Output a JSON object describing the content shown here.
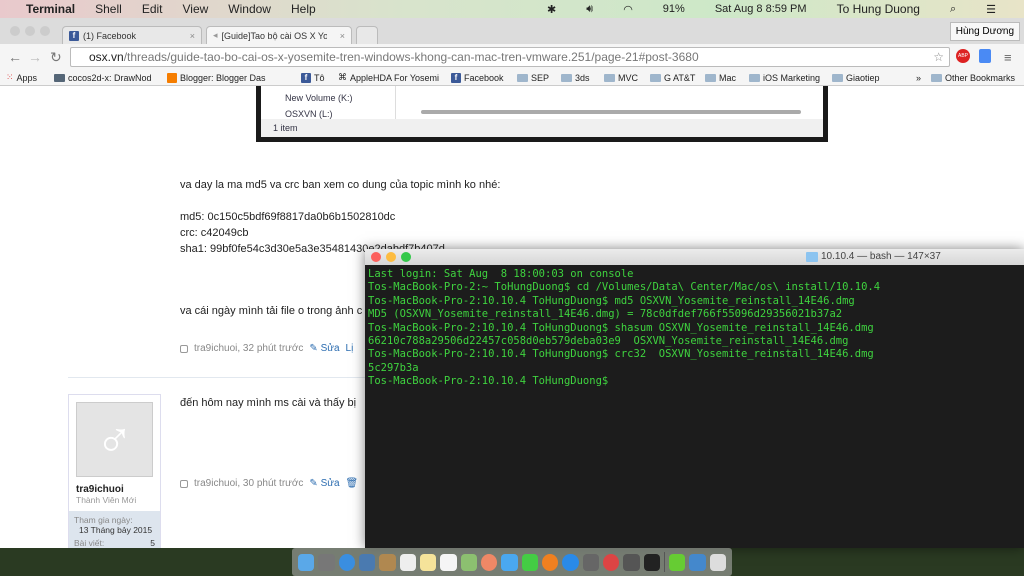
{
  "menubar": {
    "app": "Terminal",
    "items": [
      "Shell",
      "Edit",
      "View",
      "Window",
      "Help"
    ],
    "battery": "91%",
    "clock": "Sat Aug 8  8:59 PM",
    "user": "To Hung Duong"
  },
  "browser": {
    "tabs": [
      {
        "label": "(1) Facebook"
      },
      {
        "label": "[Guide]Tao bộ cài OS X Yose"
      }
    ],
    "profile": "Hùng Dương",
    "url_host": "osx.vn",
    "url_path": "/threads/guide-tao-bo-cai-os-x-yosemite-tren-windows-khong-can-mac-tren-vmware.251/page-21#post-3680",
    "bookmarks": [
      "Apps",
      "cocos2d-x: DrawNod",
      "Blogger: Blogger Das",
      "Tô",
      "AppleHDA For Yosemi",
      "Facebook",
      "SEP",
      "3ds",
      "MVC",
      "G AT&T",
      "Mac",
      "iOS Marketing",
      "Giaotiep",
      "»",
      "Other Bookmarks"
    ]
  },
  "page": {
    "explorer": {
      "drives": [
        "New Volume (K:)",
        "OSXVN (L:)"
      ],
      "status": "1 item"
    },
    "post1": {
      "intro": "va day la ma md5 va crc ban xem co dung của topic mình ko nhé:",
      "md5": "md5: 0c150c5bdf69f8817da0b6b1502810dc",
      "crc": "crc: c42049cb",
      "sha1": "sha1: 99bf0fe54c3d30e5a3e35481430e2dabdf7b407d",
      "text2": "va cái ngày mình tải file o trong ảnh c",
      "meta": "tra9ichuoi, 32 phút trước",
      "edit": "Sửa",
      "more": "Lị"
    },
    "post2": {
      "text": "đến hôm nay mình ms cài và thấy bị",
      "meta": "tra9ichuoi, 30 phút trước",
      "edit": "Sửa"
    },
    "user": {
      "name": "tra9ichuoi",
      "title": "Thành Viên Mới",
      "joined_label": "Tham gia ngày:",
      "joined": "13 Tháng bảy 2015",
      "posts_label": "Bài viết:",
      "posts": "5"
    }
  },
  "terminal": {
    "title": "10.10.4 — bash — 147×37",
    "lines": [
      "Last login: Sat Aug  8 18:00:03 on console",
      "Tos-MacBook-Pro-2:~ ToHungDuong$ cd /Volumes/Data\\ Center/Mac/os\\ install/10.10.4",
      "Tos-MacBook-Pro-2:10.10.4 ToHungDuong$ md5 OSXVN_Yosemite_reinstall_14E46.dmg",
      "MD5 (OSXVN_Yosemite_reinstall_14E46.dmg) = 78c0dfdef766f55096d29356021b37a2",
      "Tos-MacBook-Pro-2:10.10.4 ToHungDuong$ shasum OSXVN_Yosemite_reinstall_14E46.dmg",
      "66210c788a29506d22457c058d0eb579deba03e9  OSXVN_Yosemite_reinstall_14E46.dmg",
      "Tos-MacBook-Pro-2:10.10.4 ToHungDuong$ crc32  OSXVN_Yosemite_reinstall_14E46.dmg",
      "5c297b3a",
      "Tos-MacBook-Pro-2:10.10.4 ToHungDuong$ "
    ]
  },
  "dock": {
    "apps": [
      "Finder",
      "Launchpad",
      "Safari",
      "Preview",
      "Contacts",
      "Calendar",
      "Notes",
      "Reminders",
      "Maps",
      "Photos",
      "Messages",
      "FaceTime",
      "iBooks",
      "App Store",
      "System Preferences",
      "Chrome",
      "Sublime Text",
      "Terminal",
      "Downloads",
      "Applications",
      "Trash"
    ],
    "colors": [
      "#5aa8e8",
      "#777",
      "#3a8ee0",
      "#4a7ab0",
      "#b08850",
      "#eee",
      "#f5e39a",
      "#f5f5f5",
      "#8cc070",
      "#e86",
      "#4aa8f0",
      "#4c4",
      "#f08020",
      "#2a8ae8",
      "#666",
      "#d44",
      "#555",
      "#222",
      "#6c3",
      "#48c",
      "#ddd"
    ]
  }
}
